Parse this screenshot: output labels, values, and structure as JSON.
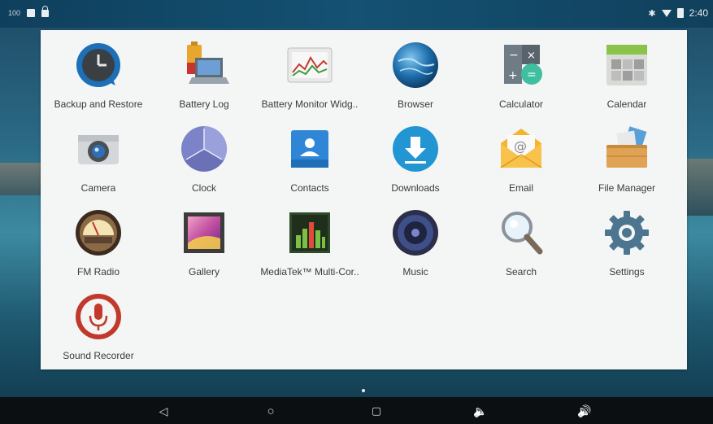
{
  "status_bar": {
    "left_text": "100",
    "time": "2:40"
  },
  "apps": [
    {
      "label": "Backup and Restore",
      "icon": "backup-restore-icon"
    },
    {
      "label": "Battery Log",
      "icon": "battery-log-icon"
    },
    {
      "label": "Battery Monitor Widg..",
      "icon": "battery-monitor-icon"
    },
    {
      "label": "Browser",
      "icon": "browser-globe-icon"
    },
    {
      "label": "Calculator",
      "icon": "calculator-icon"
    },
    {
      "label": "Calendar",
      "icon": "calendar-icon"
    },
    {
      "label": "Camera",
      "icon": "camera-icon"
    },
    {
      "label": "Clock",
      "icon": "clock-icon"
    },
    {
      "label": "Contacts",
      "icon": "contacts-icon"
    },
    {
      "label": "Downloads",
      "icon": "downloads-icon"
    },
    {
      "label": "Email",
      "icon": "email-icon"
    },
    {
      "label": "File Manager",
      "icon": "file-manager-icon"
    },
    {
      "label": "FM Radio",
      "icon": "fm-radio-icon"
    },
    {
      "label": "Gallery",
      "icon": "gallery-icon"
    },
    {
      "label": "MediaTek™ Multi-Cor..",
      "icon": "mediatek-multicore-icon"
    },
    {
      "label": "Music",
      "icon": "music-speaker-icon"
    },
    {
      "label": "Search",
      "icon": "search-magnifier-icon"
    },
    {
      "label": "Settings",
      "icon": "settings-gear-icon"
    },
    {
      "label": "Sound Recorder",
      "icon": "sound-recorder-icon"
    }
  ],
  "nav": {
    "back": "◁",
    "home": "○",
    "recents": "▢",
    "vol_down": "🔈",
    "vol_up": "🔊"
  },
  "colors": {
    "drawer_bg": "#f4f5f5",
    "nav_bg": "#0b0f12",
    "status_bg": "#145173"
  }
}
